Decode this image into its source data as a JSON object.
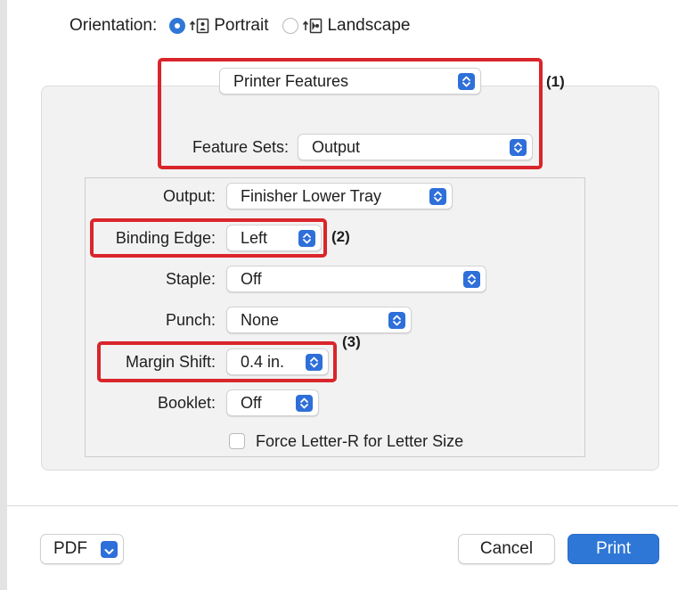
{
  "orientation": {
    "label": "Orientation:",
    "options": [
      {
        "label": "Portrait",
        "selected": true
      },
      {
        "label": "Landscape",
        "selected": false
      }
    ]
  },
  "panel_select": {
    "value": "Printer Features"
  },
  "feature_sets": {
    "label": "Feature Sets:",
    "value": "Output"
  },
  "fields": {
    "output": {
      "label": "Output:",
      "value": "Finisher Lower Tray"
    },
    "binding_edge": {
      "label": "Binding Edge:",
      "value": "Left"
    },
    "staple": {
      "label": "Staple:",
      "value": "Off"
    },
    "punch": {
      "label": "Punch:",
      "value": "None"
    },
    "margin_shift": {
      "label": "Margin Shift:",
      "value": "0.4 in."
    },
    "booklet": {
      "label": "Booklet:",
      "value": "Off"
    }
  },
  "force_letter": {
    "label": "Force Letter-R for Letter Size",
    "checked": false
  },
  "annotations": {
    "one": "(1)",
    "two": "(2)",
    "three": "(3)"
  },
  "buttons": {
    "pdf": "PDF",
    "cancel": "Cancel",
    "print": "Print"
  },
  "colors": {
    "accent": "#2f77d6",
    "highlight": "#d9252b",
    "panel": "#f2f2f2"
  }
}
